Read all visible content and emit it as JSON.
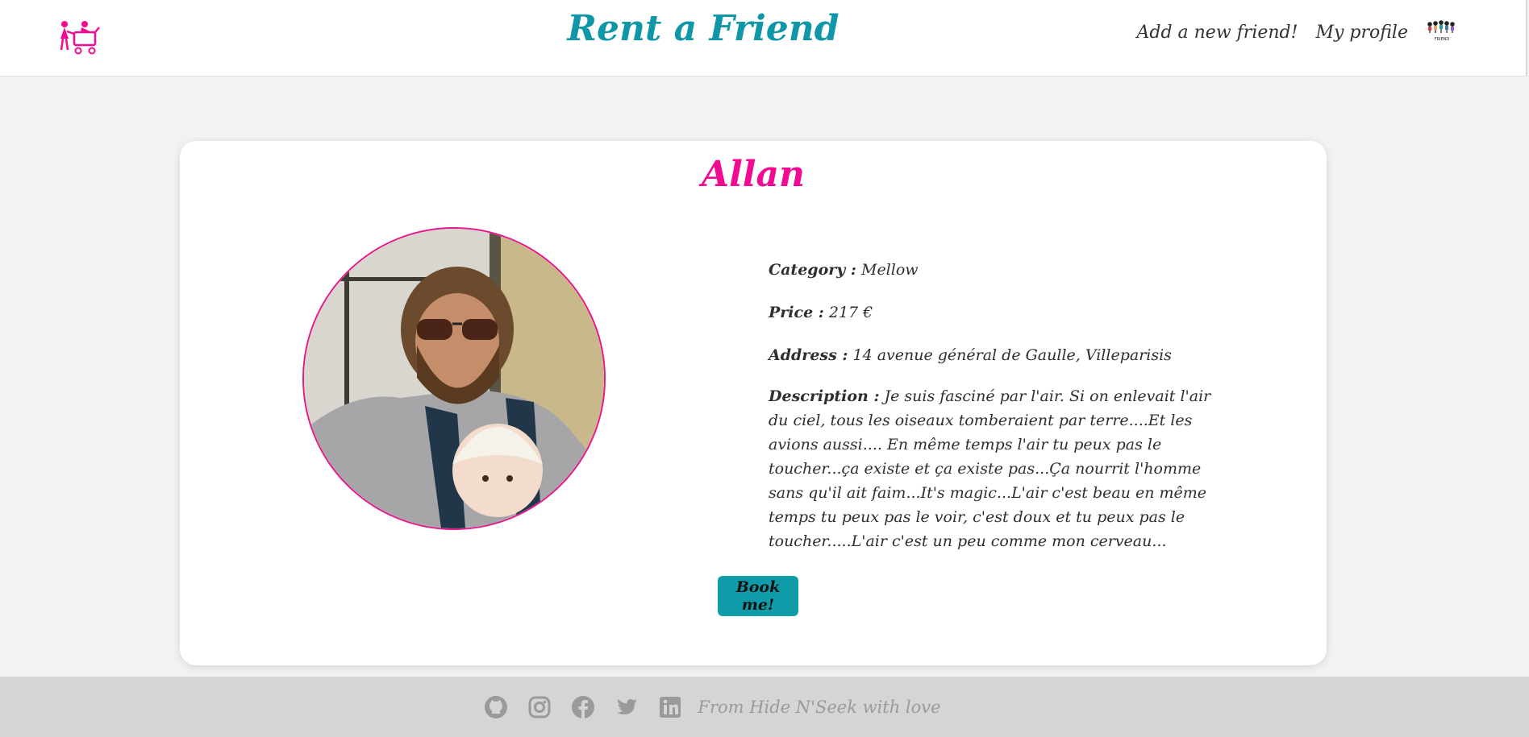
{
  "header": {
    "title": "Rent a Friend",
    "nav": {
      "add_friend": "Add a new friend!",
      "my_profile": "My profile"
    },
    "avatar_caption": "FRIEND"
  },
  "friend": {
    "name": "Allan",
    "details": [
      {
        "label": "Category :",
        "value": "Mellow"
      },
      {
        "label": "Price :",
        "value": "217 €"
      },
      {
        "label": "Address :",
        "value": "14 avenue général de Gaulle, Villeparisis"
      }
    ],
    "description_label": "Description :",
    "description": "Je suis fasciné par l'air. Si on enlevait l'air du ciel, tous les oiseaux tomberaient par terre....Et les avions aussi.... En même temps l'air tu peux pas le toucher...ça existe et ça existe pas...Ça nourrit l'homme sans qu'il ait faim...It's magic...L'air c'est beau en même temps tu peux pas le voir, c'est doux et tu peux pas le toucher.....L'air c'est un peu comme mon cerveau..."
  },
  "book_button": "Book me!",
  "footer": {
    "icons": [
      "github-icon",
      "instagram-icon",
      "facebook-icon",
      "twitter-icon",
      "linkedin-icon"
    ],
    "text": "From Hide N'Seek with love"
  },
  "colors": {
    "brand_teal": "#0f97a8",
    "accent_pink": "#f20a93",
    "background": "#f2f2f2",
    "footer_bg": "#d5d5d5"
  }
}
